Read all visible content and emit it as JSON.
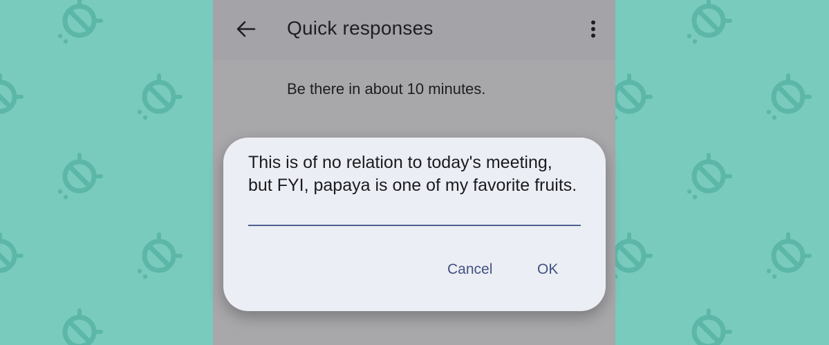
{
  "app": {
    "title": "Quick responses"
  },
  "list": {
    "items": [
      {
        "text": "Be there in about 10 minutes."
      }
    ]
  },
  "dialog": {
    "field_value": "This is of no relation to today's meeting, but FYI, papaya is one of my favorite fruits.",
    "cancel_label": "Cancel",
    "ok_label": "OK"
  },
  "colors": {
    "background": "#79cbbd",
    "pattern": "#5cb7a8",
    "scrim": "#a8a7aa",
    "dialog": "#eceef5",
    "accent": "#41527f"
  },
  "icons": {
    "back": "arrow-left",
    "overflow": "more-vertical",
    "wallpaper": "bug-prohibited"
  }
}
